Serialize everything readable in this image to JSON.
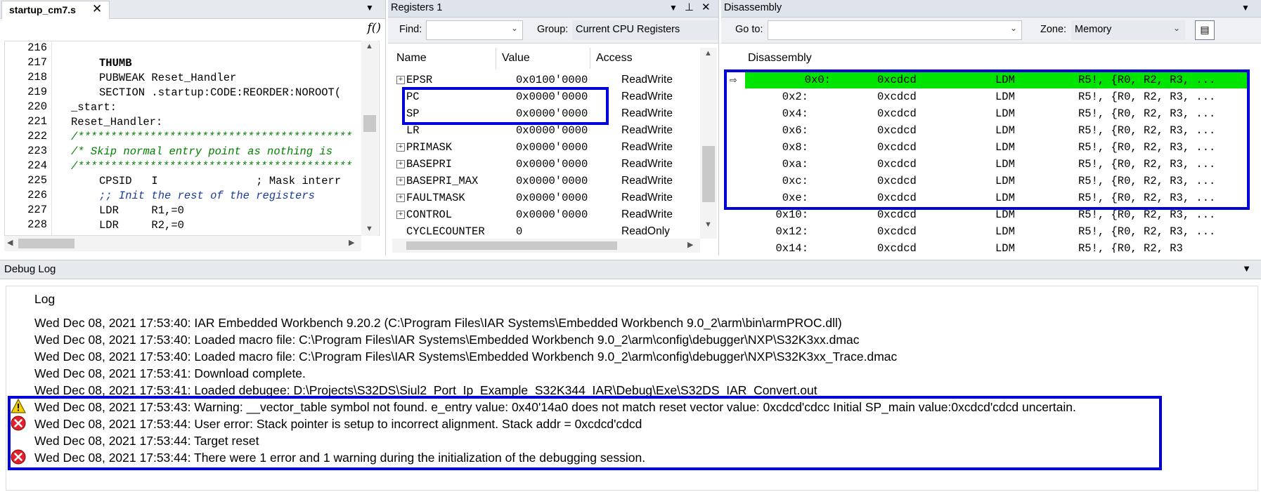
{
  "editor": {
    "tab_label": "startup_cm7.s",
    "close_glyph": "✕",
    "func_glyph": "f()",
    "lines": [
      {
        "num": "216",
        "text": ""
      },
      {
        "num": "217",
        "text": "THUMB"
      },
      {
        "num": "218",
        "text": "PUBWEAK Reset_Handler"
      },
      {
        "num": "219",
        "text": "SECTION .startup:CODE:REORDER:NOROOT("
      },
      {
        "num": "220",
        "text": "_start:"
      },
      {
        "num": "221",
        "text": "Reset_Handler:"
      },
      {
        "num": "222",
        "text": "/******************************************"
      },
      {
        "num": "223",
        "text": "/* Skip normal entry point as nothing is"
      },
      {
        "num": "224",
        "text": "/******************************************"
      },
      {
        "num": "225",
        "text": "CPSID   I               ; Mask interr"
      },
      {
        "num": "226",
        "text": ";; Init the rest of the registers"
      },
      {
        "num": "227",
        "text": "LDR     R1,=0"
      },
      {
        "num": "228",
        "text": "LDR     R2,=0"
      }
    ]
  },
  "registers": {
    "title": "Registers 1",
    "find_label": "Find:",
    "find_value": "",
    "group_label": "Group:",
    "group_value": "Current CPU Registers",
    "columns": [
      "Name",
      "Value",
      "Access"
    ],
    "rows": [
      {
        "name": "EPSR",
        "value": "0x0100'0000",
        "access": "ReadWrite",
        "expandable": true
      },
      {
        "name": "PC",
        "value": "0x0000'0000",
        "access": "ReadWrite",
        "expandable": false
      },
      {
        "name": "SP",
        "value": "0x0000'0000",
        "access": "ReadWrite",
        "expandable": false
      },
      {
        "name": "LR",
        "value": "0x0000'0000",
        "access": "ReadWrite",
        "expandable": false
      },
      {
        "name": "PRIMASK",
        "value": "0x0000'0000",
        "access": "ReadWrite",
        "expandable": true
      },
      {
        "name": "BASEPRI",
        "value": "0x0000'0000",
        "access": "ReadWrite",
        "expandable": true
      },
      {
        "name": "BASEPRI_MAX",
        "value": "0x0000'0000",
        "access": "ReadWrite",
        "expandable": true
      },
      {
        "name": "FAULTMASK",
        "value": "0x0000'0000",
        "access": "ReadWrite",
        "expandable": true
      },
      {
        "name": "CONTROL",
        "value": "0x0000'0000",
        "access": "ReadWrite",
        "expandable": true
      },
      {
        "name": "CYCLECOUNTER",
        "value": "0",
        "access": "ReadOnly",
        "expandable": false
      }
    ]
  },
  "disassembly": {
    "title": "Disassembly",
    "goto_label": "Go to:",
    "goto_value": "",
    "zone_label": "Zone:",
    "zone_value": "Memory",
    "column_header": "Disassembly",
    "rows": [
      {
        "addr": "0x0:",
        "opcode": "0xcdcd",
        "mnemonic": "LDM",
        "args": "R5!, {R0, R2, R3, ...",
        "current": true
      },
      {
        "addr": "0x2:",
        "opcode": "0xcdcd",
        "mnemonic": "LDM",
        "args": "R5!, {R0, R2, R3, ...",
        "current": false
      },
      {
        "addr": "0x4:",
        "opcode": "0xcdcd",
        "mnemonic": "LDM",
        "args": "R5!, {R0, R2, R3, ...",
        "current": false
      },
      {
        "addr": "0x6:",
        "opcode": "0xcdcd",
        "mnemonic": "LDM",
        "args": "R5!, {R0, R2, R3, ...",
        "current": false
      },
      {
        "addr": "0x8:",
        "opcode": "0xcdcd",
        "mnemonic": "LDM",
        "args": "R5!, {R0, R2, R3, ...",
        "current": false
      },
      {
        "addr": "0xa:",
        "opcode": "0xcdcd",
        "mnemonic": "LDM",
        "args": "R5!, {R0, R2, R3, ...",
        "current": false
      },
      {
        "addr": "0xc:",
        "opcode": "0xcdcd",
        "mnemonic": "LDM",
        "args": "R5!, {R0, R2, R3, ...",
        "current": false
      },
      {
        "addr": "0xe:",
        "opcode": "0xcdcd",
        "mnemonic": "LDM",
        "args": "R5!, {R0, R2, R3, ...",
        "current": false
      },
      {
        "addr": "0x10:",
        "opcode": "0xcdcd",
        "mnemonic": "LDM",
        "args": "R5!, {R0, R2, R3, ...",
        "current": false
      },
      {
        "addr": "0x12:",
        "opcode": "0xcdcd",
        "mnemonic": "LDM",
        "args": "R5!, {R0, R2, R3, ...",
        "current": false
      },
      {
        "addr": "0x14:",
        "opcode": "0xcdcd",
        "mnemonic": "LDM",
        "args": "R5!, {R0, R2, R3",
        "current": false
      }
    ]
  },
  "debug_log": {
    "title": "Debug Log",
    "column_header": "Log",
    "entries": [
      {
        "level": "info",
        "text": "Wed Dec 08, 2021 17:53:40: IAR Embedded Workbench 9.20.2 (C:\\Program Files\\IAR Systems\\Embedded Workbench 9.0_2\\arm\\bin\\armPROC.dll)"
      },
      {
        "level": "info",
        "text": "Wed Dec 08, 2021 17:53:40: Loaded macro file: C:\\Program Files\\IAR Systems\\Embedded Workbench 9.0_2\\arm\\config\\debugger\\NXP\\S32K3xx.dmac"
      },
      {
        "level": "info",
        "text": "Wed Dec 08, 2021 17:53:40: Loaded macro file: C:\\Program Files\\IAR Systems\\Embedded Workbench 9.0_2\\arm\\config\\debugger\\NXP\\S32K3xx_Trace.dmac"
      },
      {
        "level": "info",
        "text": "Wed Dec 08, 2021 17:53:41: Download complete."
      },
      {
        "level": "info",
        "text": "Wed Dec 08, 2021 17:53:41: Loaded debugee: D:\\Projects\\S32DS\\Siul2_Port_Ip_Example_S32K344_IAR\\Debug\\Exe\\S32DS_IAR_Convert.out"
      },
      {
        "level": "warning",
        "text": "Wed Dec 08, 2021 17:53:43: Warning: __vector_table symbol not found. e_entry value: 0x40'14a0 does not match reset vector value: 0xcdcd'cdcc Initial SP_main value:0xcdcd'cdcd uncertain."
      },
      {
        "level": "error",
        "text": "Wed Dec 08, 2021 17:53:44: User error: Stack pointer is setup to incorrect alignment.  Stack addr = 0xcdcd'cdcd"
      },
      {
        "level": "info",
        "text": "Wed Dec 08, 2021 17:53:44: Target reset"
      },
      {
        "level": "error",
        "text": "Wed Dec 08, 2021 17:53:44: There were 1 error and 1 warning during the initialization of the debugging session."
      }
    ]
  },
  "colors": {
    "highlight_box": "#0000d8",
    "current_line": "#00e400",
    "comment_green": "#008000",
    "comment_blue": "#1a3c9b"
  }
}
